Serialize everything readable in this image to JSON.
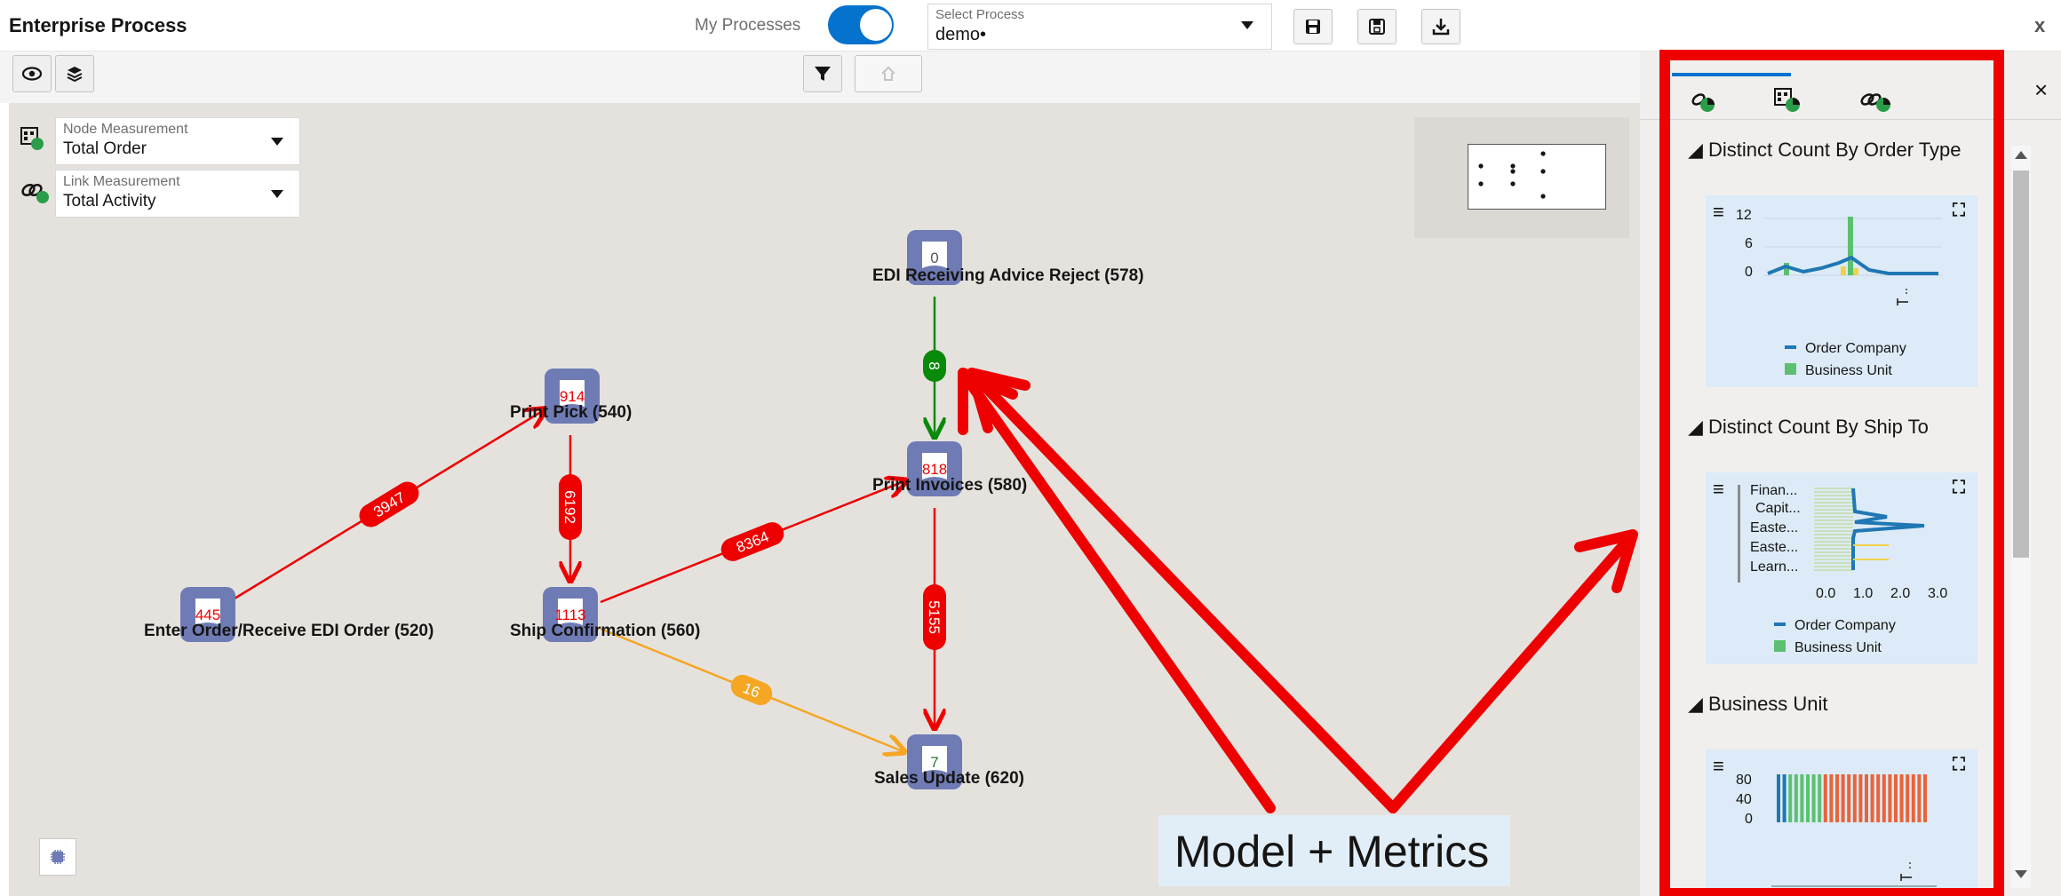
{
  "header": {
    "title": "Enterprise Process",
    "my_processes_label": "My Processes",
    "select_process_label": "Select Process",
    "select_process_value": "demo•",
    "close_label": "x"
  },
  "measurements": {
    "node_label": "Node Measurement",
    "node_value": "Total Order",
    "link_label": "Link Measurement",
    "link_value": "Total Activity"
  },
  "graph": {
    "nodes": [
      {
        "id": "enter-order",
        "badge": "445",
        "label": "Enter Order/Receive EDI Order (520)"
      },
      {
        "id": "print-pick",
        "badge": "914",
        "label": "Print Pick (540)"
      },
      {
        "id": "ship-confirmation",
        "badge": "1113",
        "label": "Ship Confirmation (560)"
      },
      {
        "id": "edi-reject",
        "badge": "0",
        "label": "EDI Receiving Advice Reject (578)"
      },
      {
        "id": "print-invoices",
        "badge": "818",
        "label": "Print Invoices (580)"
      },
      {
        "id": "sales-update",
        "badge": "7",
        "label": "Sales Update (620)"
      }
    ],
    "links": [
      {
        "from": "enter-order",
        "to": "print-pick",
        "value": "3947",
        "color": "#ee0000"
      },
      {
        "from": "print-pick",
        "to": "ship-confirmation",
        "value": "6192",
        "color": "#ee0000"
      },
      {
        "from": "ship-confirmation",
        "to": "print-invoices",
        "value": "8364",
        "color": "#ee0000"
      },
      {
        "from": "ship-confirmation",
        "to": "sales-update",
        "value": "16",
        "color": "#f5a623"
      },
      {
        "from": "edi-reject",
        "to": "print-invoices",
        "value": "8",
        "color": "#0a8a0a"
      },
      {
        "from": "print-invoices",
        "to": "sales-update",
        "value": "5155",
        "color": "#ee0000"
      }
    ]
  },
  "panel": {
    "close_label": "×",
    "sections": [
      {
        "title": "Distinct Count By Order Type",
        "y_ticks": [
          "12",
          "6",
          "0"
        ],
        "legend": [
          "Order Company",
          "Business Unit"
        ]
      },
      {
        "title": "Distinct Count By Ship To",
        "y_labels": [
          "Finan...",
          "Capit...",
          "Easte...",
          "Easte...",
          "Learn..."
        ],
        "x_ticks": [
          "0.0",
          "1.0",
          "2.0",
          "3.0"
        ],
        "legend": [
          "Order Company",
          "Business Unit"
        ]
      },
      {
        "title": "Business Unit",
        "y_ticks": [
          "80",
          "40",
          "0"
        ]
      }
    ]
  },
  "annotation": {
    "text": "Model + Metrics",
    "color": "#ee0000"
  },
  "colors": {
    "accent": "#0572ce",
    "node_fill": "#6e7bb5",
    "series_blue": "#1f77b4",
    "series_green": "#5cc070",
    "series_orange": "#e8643a"
  }
}
